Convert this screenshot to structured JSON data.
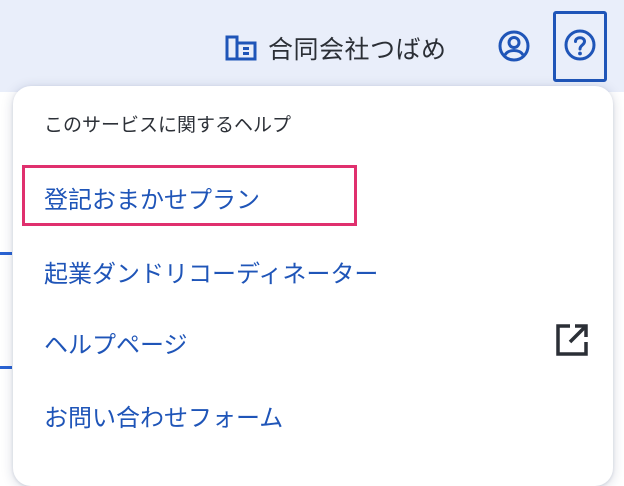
{
  "header": {
    "company_name": "合同会社つばめ",
    "company_icon": "company-building-icon",
    "account_icon": "account-circle-icon",
    "help_icon": "help-circle-icon"
  },
  "help_menu": {
    "heading": "このサービスに関するヘルプ",
    "items": [
      {
        "label": "登記おまかせプラン",
        "highlighted": true
      },
      {
        "label": "起業ダンドリコーディネーター"
      },
      {
        "label": "ヘルプページ",
        "trailing_icon": "open-in-new-icon"
      },
      {
        "label": "お問い合わせフォーム"
      }
    ]
  },
  "colors": {
    "header_background": "#e9eefa",
    "link_blue": "#1f55b8",
    "text_dark": "#2b2f36",
    "highlight_pink": "#e0306e"
  }
}
